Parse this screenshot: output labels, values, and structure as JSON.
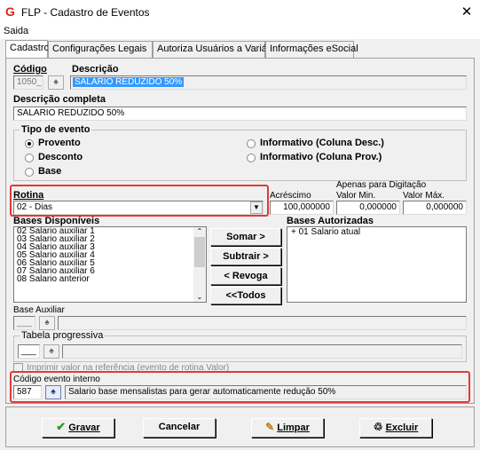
{
  "window": {
    "title": "FLP - Cadastro de Eventos",
    "close": "✕"
  },
  "menu": {
    "saida": "Saida"
  },
  "tabs": [
    "Cadastro",
    "Configurações Legais",
    "Autoriza Usuários a Variáveis",
    "Informações eSocial"
  ],
  "codigo": {
    "label": "Código",
    "value": "1050_"
  },
  "descricao": {
    "label": "Descrição",
    "value": "SALARIO REDUZIDO 50%"
  },
  "descricao_completa": {
    "label": "Descrição completa",
    "value": "SALARIO REDUZIDO 50%"
  },
  "tipo_evento": {
    "title": "Tipo de evento",
    "options": [
      "Provento",
      "Desconto",
      "Base",
      "Informativo (Coluna Desc.)",
      "Informativo (Coluna Prov.)"
    ],
    "selected": "Provento"
  },
  "rotina": {
    "label": "Rotina",
    "value": "02 - Dias"
  },
  "digitacao": {
    "header": "Apenas para Digitação",
    "acrescimo_label": "Acréscimo",
    "acrescimo": "100,000000",
    "min_label": "Valor Min.",
    "min": "0,000000",
    "max_label": "Valor Máx.",
    "max": "0,000000"
  },
  "bases_disponiveis": {
    "label": "Bases Disponíveis",
    "items": [
      "02 Salario auxiliar 1",
      "03 Salario auxiliar 2",
      "04 Salario auxiliar 3",
      "05 Salario auxiliar 4",
      "06 Salario auxiliar 5",
      "07 Salario auxiliar 6",
      "08 Salario anterior"
    ]
  },
  "bases_autorizadas": {
    "label": "Bases Autorizadas",
    "items": [
      "+ 01 Salario atual"
    ]
  },
  "buttons_mid": [
    "Somar >",
    "Subtrair >",
    "< Revoga",
    "<<Todos"
  ],
  "base_auxiliar": {
    "label": "Base Auxiliar",
    "value": "___"
  },
  "tabela_progressiva": {
    "label": "Tabela progressiva",
    "value": "___"
  },
  "imprimir_valor": {
    "label": "Imprimir valor na referência (evento de rotina Valor)"
  },
  "codigo_evento_interno": {
    "label": "Código evento interno",
    "value": "587",
    "description": "Salario base mensalistas para gerar automaticamente redução 50%"
  },
  "bottom_buttons": {
    "gravar": "Gravar",
    "cancelar": "Cancelar",
    "limpar": "Limpar",
    "excluir": "Excluir"
  },
  "colors": {
    "highlight": "#e03a3a",
    "selection": "#3399ff",
    "app_icon": "#d9261c"
  }
}
